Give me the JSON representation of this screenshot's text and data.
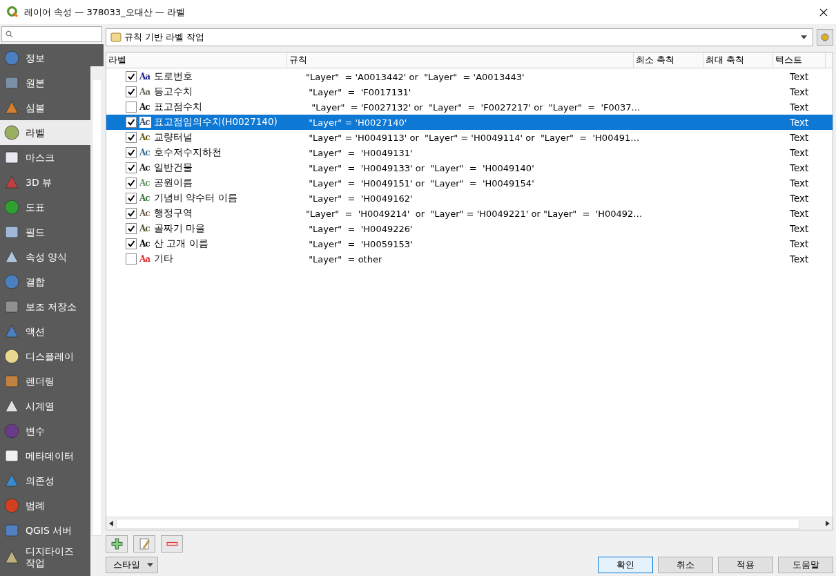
{
  "window": {
    "title": "레이어 속성 — 378033_오대산 — 라벨"
  },
  "sidebar": {
    "items": [
      {
        "label": "정보",
        "selected": false
      },
      {
        "label": "원본",
        "selected": false
      },
      {
        "label": "심볼",
        "selected": false
      },
      {
        "label": "라벨",
        "selected": true
      },
      {
        "label": "마스크",
        "selected": false
      },
      {
        "label": "3D 뷰",
        "selected": false
      },
      {
        "label": "도표",
        "selected": false
      },
      {
        "label": "필드",
        "selected": false
      },
      {
        "label": "속성 양식",
        "selected": false
      },
      {
        "label": "결합",
        "selected": false
      },
      {
        "label": "보조 저장소",
        "selected": false
      },
      {
        "label": "액션",
        "selected": false
      },
      {
        "label": "디스플레이",
        "selected": false
      },
      {
        "label": "렌더링",
        "selected": false
      },
      {
        "label": "시계열",
        "selected": false
      },
      {
        "label": "변수",
        "selected": false
      },
      {
        "label": "메타데이터",
        "selected": false
      },
      {
        "label": "의존성",
        "selected": false
      },
      {
        "label": "범례",
        "selected": false
      },
      {
        "label": "QGIS 서버",
        "selected": false
      },
      {
        "label": "디지타이즈 작업",
        "selected": false
      }
    ]
  },
  "mode_combo": {
    "value": "규칙 기반 라벨 작업"
  },
  "table": {
    "columns": [
      "라벨",
      "규칙",
      "최소 축척",
      "최대 축척",
      "텍스트"
    ],
    "rows": [
      {
        "checked": true,
        "selected": false,
        "preview": "Aa",
        "color": "#1a1a8c",
        "label": "도로번호",
        "rule": "\"Layer\"  = 'A0013442' or  \"Layer\"  = 'A0013443'",
        "text": "Text"
      },
      {
        "checked": true,
        "selected": false,
        "preview": "Aa",
        "color": "#6b6b5a",
        "label": "등고수치",
        "rule": " \"Layer\"  =  'F0017131'",
        "text": "Text"
      },
      {
        "checked": false,
        "selected": false,
        "preview": "Ac",
        "color": "#111111",
        "label": "표고점수치",
        "rule": "  \"Layer\"  = 'F0027132' or  \"Layer\"  =  'F0027217' or  \"Layer\"  =  'F0037…",
        "text": "Text"
      },
      {
        "checked": true,
        "selected": true,
        "preview": "Ac",
        "color": "#3c5070",
        "label": "표고점임의수치(H0027140)",
        "rule": " \"Layer\" = 'H0027140'",
        "text": "Text"
      },
      {
        "checked": true,
        "selected": false,
        "preview": "Ac",
        "color": "#6a5a10",
        "label": "교량터널",
        "rule": " \"Layer\" = 'H0049113' or  \"Layer\" = 'H0049114' or  \"Layer\"  =  'H00491…",
        "text": "Text"
      },
      {
        "checked": true,
        "selected": false,
        "preview": "Ac",
        "color": "#3a6e8a",
        "label": "호수저수지하천",
        "rule": " \"Layer\"  =  'H0049131'",
        "text": "Text"
      },
      {
        "checked": true,
        "selected": false,
        "preview": "Ac",
        "color": "#222222",
        "label": "일반건물",
        "rule": " \"Layer\"  =  'H0049133' or  \"Layer\"  =  'H0049140'",
        "text": "Text"
      },
      {
        "checked": true,
        "selected": false,
        "preview": "Ac",
        "color": "#6a9a6a",
        "label": "공원이름",
        "rule": " \"Layer\"  =  'H0049151' or  \"Layer\"  =  'H0049154'",
        "text": "Text"
      },
      {
        "checked": true,
        "selected": false,
        "preview": "Ac",
        "color": "#3d7a3d",
        "label": "기념비 약수터 이름",
        "rule": " \"Layer\"  =  'H0049162'",
        "text": "Text"
      },
      {
        "checked": true,
        "selected": false,
        "preview": "Ac",
        "color": "#6e6250",
        "label": "행정구역",
        "rule": "\"Layer\"  =  'H0049214'  or  \"Layer\" = 'H0049221' or \"Layer\"  =  'H00492…",
        "text": "Text"
      },
      {
        "checked": true,
        "selected": false,
        "preview": "Ac",
        "color": "#4a5a30",
        "label": "골짜기 마을",
        "rule": " \"Layer\"  =  'H0049226'",
        "text": "Text"
      },
      {
        "checked": true,
        "selected": false,
        "preview": "Ac",
        "color": "#000000",
        "label": "산 고개 이름",
        "rule": " \"Layer\"  =  'H0059153'",
        "text": "Text"
      },
      {
        "checked": false,
        "selected": false,
        "preview": "Aa",
        "color": "#e03030",
        "label": "기타",
        "rule": " \"Layer\"  = other",
        "text": "Text"
      }
    ]
  },
  "style_button": {
    "label": "스타일"
  },
  "buttons": [
    {
      "label": "확인",
      "selected": true
    },
    {
      "label": "취소",
      "selected": false
    },
    {
      "label": "적용",
      "selected": false
    },
    {
      "label": "도움말",
      "selected": false
    }
  ]
}
